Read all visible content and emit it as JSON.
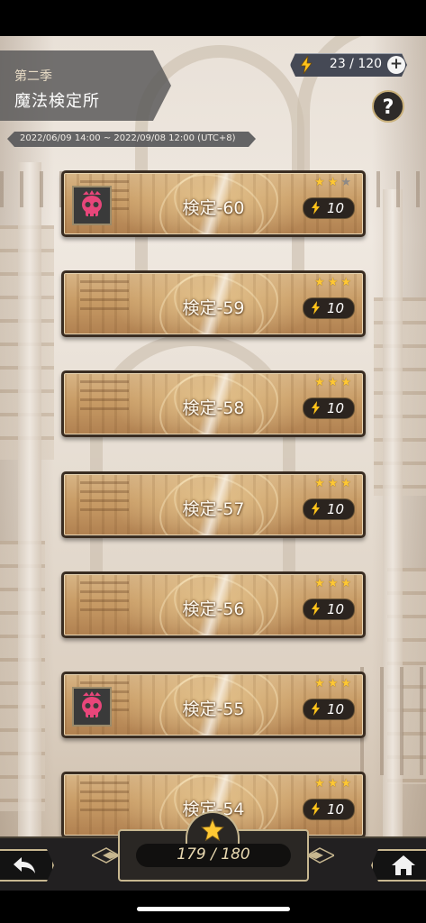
{
  "header": {
    "season": "第二季",
    "title": "魔法検定所",
    "period": "2022/06/09 14:00 ~ 2022/09/08 12:00 (UTC+8)"
  },
  "energy": {
    "value": "23 / 120",
    "icon": "lightning-icon",
    "add_label": "+"
  },
  "help": {
    "label": "?"
  },
  "stages": [
    {
      "label": "検定-60",
      "cost": "10",
      "stars": 2,
      "max_stars": 3,
      "boss": true
    },
    {
      "label": "検定-59",
      "cost": "10",
      "stars": 3,
      "max_stars": 3,
      "boss": false
    },
    {
      "label": "検定-58",
      "cost": "10",
      "stars": 3,
      "max_stars": 3,
      "boss": false
    },
    {
      "label": "検定-57",
      "cost": "10",
      "stars": 3,
      "max_stars": 3,
      "boss": false
    },
    {
      "label": "検定-56",
      "cost": "10",
      "stars": 3,
      "max_stars": 3,
      "boss": false
    },
    {
      "label": "検定-55",
      "cost": "10",
      "stars": 3,
      "max_stars": 3,
      "boss": true
    },
    {
      "label": "検定-54",
      "cost": "10",
      "stars": 3,
      "max_stars": 3,
      "boss": false
    }
  ],
  "progress": {
    "value": "179 / 180",
    "icon": "star-icon"
  },
  "colors": {
    "star_on": "#ffc833",
    "star_off": "#8e8a86",
    "boss_skull": "#e8467a",
    "frame_gold": "#c7b790"
  }
}
